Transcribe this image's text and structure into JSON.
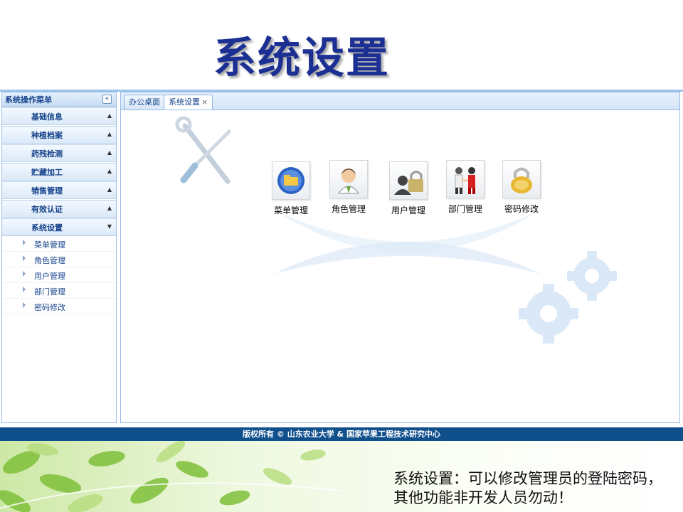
{
  "slide_title": "系统设置",
  "sidebar": {
    "title": "系统操作菜单",
    "collapse_icon": "«",
    "groups": [
      {
        "label": "基础信息",
        "arrow": "▲"
      },
      {
        "label": "种植档案",
        "arrow": "▲"
      },
      {
        "label": "药残检测",
        "arrow": "▲"
      },
      {
        "label": "贮藏加工",
        "arrow": "▲"
      },
      {
        "label": "销售管理",
        "arrow": "▲"
      },
      {
        "label": "有效认证",
        "arrow": "▲"
      },
      {
        "label": "系统设置",
        "arrow": "▼"
      }
    ],
    "sub_items": [
      "菜单管理",
      "角色管理",
      "用户管理",
      "部门管理",
      "密码修改"
    ]
  },
  "tabs": [
    {
      "label": "办公桌面"
    },
    {
      "label": "系统设置",
      "close": "×"
    }
  ],
  "tiles": [
    {
      "label": "菜单管理",
      "icon": "folder-globe-icon"
    },
    {
      "label": "角色管理",
      "icon": "user-avatar-icon"
    },
    {
      "label": "用户管理",
      "icon": "user-lock-icon"
    },
    {
      "label": "部门管理",
      "icon": "handshake-icon"
    },
    {
      "label": "密码修改",
      "icon": "gold-lock-icon"
    }
  ],
  "footer": {
    "text": "版权所有 © 山东农业大学 & 国家苹果工程技术研究中心"
  },
  "caption": "系统设置：可以修改管理员的登陆密码，其他功能非开发人员勿动！",
  "colors": {
    "title": "#1c2f93",
    "menu_text": "#15428b",
    "footer_bg": "#0f4f8c",
    "border": "#99bbe8"
  }
}
